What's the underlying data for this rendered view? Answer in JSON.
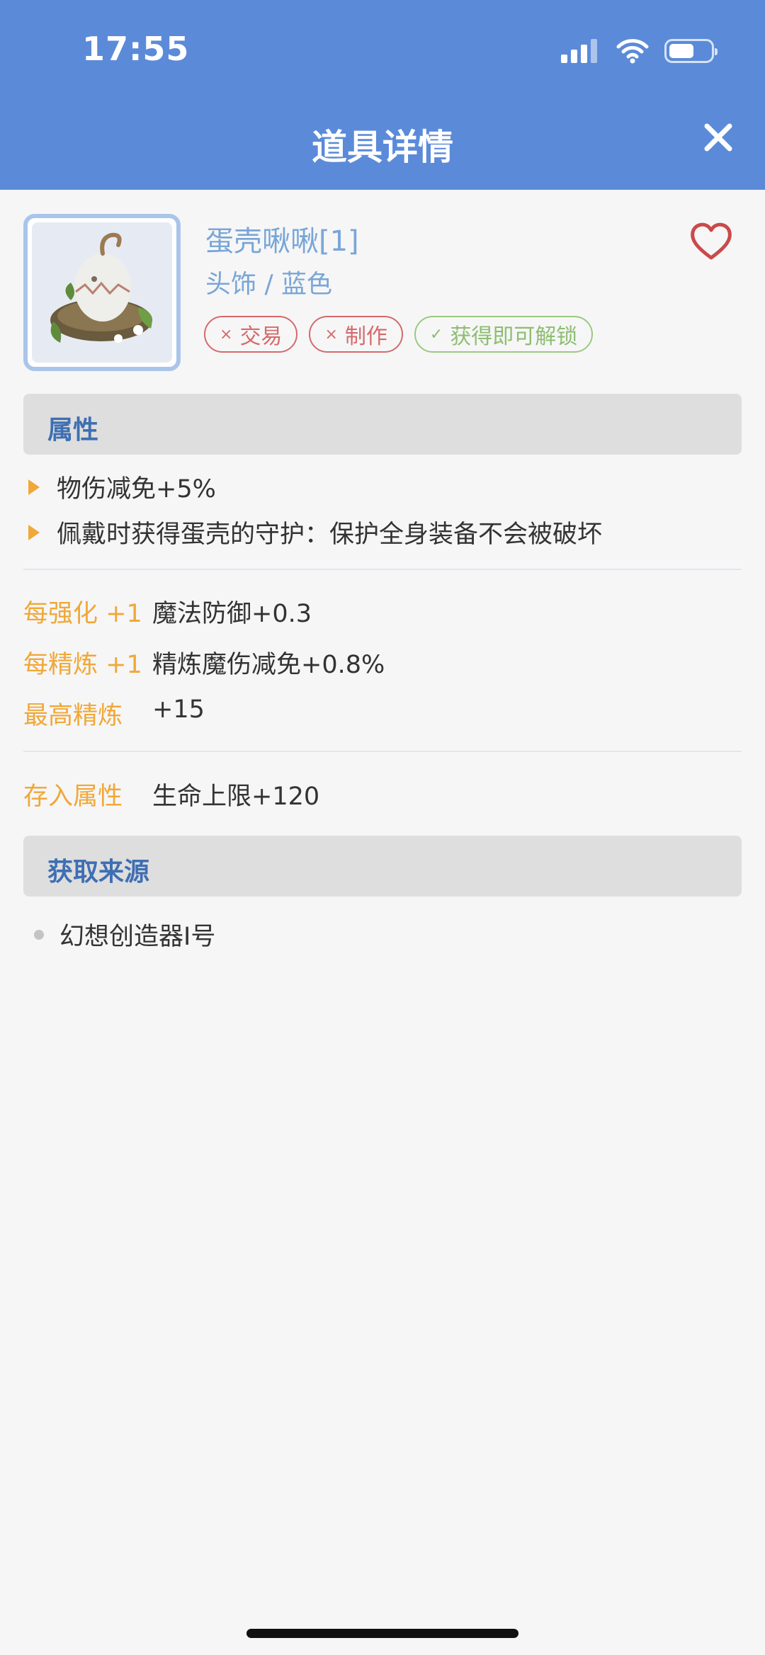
{
  "status_bar": {
    "time": "17:55",
    "battery_level": 0.6
  },
  "header": {
    "title": "道具详情",
    "close_icon": "close-icon"
  },
  "item": {
    "name": "蛋壳啾啾[1]",
    "category": "头饰 / 蓝色",
    "favorite_icon": "heart-outline-icon",
    "tags": [
      {
        "mark": "×",
        "label": "交易",
        "color": "#d56a6a"
      },
      {
        "mark": "×",
        "label": "制作",
        "color": "#d56a6a"
      },
      {
        "mark": "✓",
        "label": "获得即可解锁",
        "color": "#8dbd71"
      }
    ]
  },
  "attributes": {
    "section_title": "属性",
    "effects": [
      "物伤减免+5%",
      "佩戴时获得蛋壳的守护：保护全身装备不会被破坏"
    ],
    "upgrades": [
      {
        "key": "每强化 +1",
        "value": "魔法防御+0.3"
      },
      {
        "key": "每精炼 +1",
        "value": "精炼魔伤减免+0.8%"
      },
      {
        "key": "最高精炼",
        "value": "+15"
      }
    ],
    "deposit": {
      "key": "存入属性",
      "value": "生命上限+120"
    }
  },
  "sources": {
    "section_title": "获取来源",
    "items": [
      "幻想创造器I号"
    ]
  },
  "colors": {
    "header_bg": "#5b8ad9",
    "accent_blue": "#79a6d6",
    "section_title": "#3f6fb3",
    "key_orange": "#f0a838"
  }
}
